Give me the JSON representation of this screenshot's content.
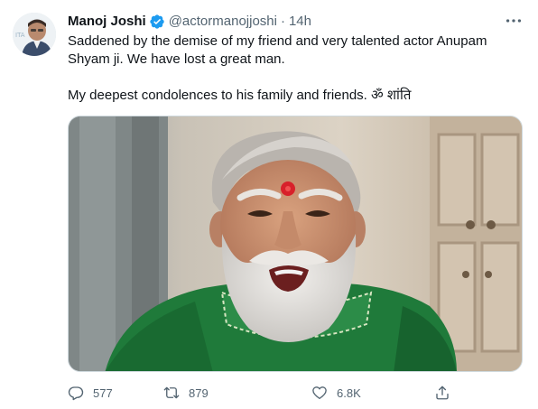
{
  "tweet": {
    "author": {
      "display_name": "Manoj Joshi",
      "verified": true,
      "handle": "@actormanojjoshi",
      "avatar_icon": "profile-photo"
    },
    "separator": "·",
    "timestamp": "14h",
    "text_paragraphs": [
      "Saddened by the demise of my friend and very talented actor Anupam Shyam ji. We have lost a great man.",
      "My deepest condolences to his family and friends. ॐ शांति"
    ],
    "media": {
      "icon": "photo-of-man-with-white-beard-green-kurta"
    },
    "actions": {
      "reply": {
        "icon": "reply-icon",
        "count": "577"
      },
      "retweet": {
        "icon": "retweet-icon",
        "count": "879"
      },
      "like": {
        "icon": "heart-icon",
        "count": "6.8K"
      },
      "share": {
        "icon": "share-icon",
        "count": ""
      }
    }
  },
  "colors": {
    "text_primary": "#0f1419",
    "text_secondary": "#536471",
    "verified_blue": "#1d9bf0",
    "border": "#cfd9de"
  }
}
